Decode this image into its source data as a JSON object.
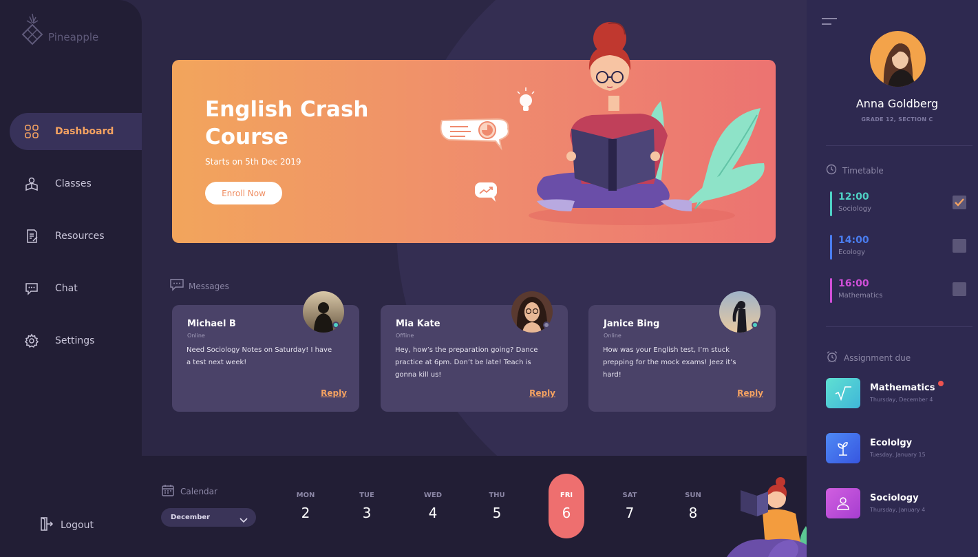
{
  "logo": {
    "name": "Pineapple"
  },
  "nav": {
    "items": [
      {
        "label": "Dashboard",
        "icon": "grid-icon",
        "active": true
      },
      {
        "label": "Classes",
        "icon": "classes-icon",
        "active": false
      },
      {
        "label": "Resources",
        "icon": "resources-icon",
        "active": false
      },
      {
        "label": "Chat",
        "icon": "chat-icon",
        "active": false
      },
      {
        "label": "Settings",
        "icon": "gear-icon",
        "active": false
      }
    ],
    "logout": "Logout"
  },
  "banner": {
    "title": "English Crash Course",
    "subtitle": "Starts on 5th Dec 2019",
    "button": "Enroll Now"
  },
  "messages": {
    "heading": "Messages",
    "reply_label": "Reply",
    "cards": [
      {
        "name": "Michael B",
        "status": "Online",
        "text": "Need Sociology Notes on Saturday! I have a test next week!"
      },
      {
        "name": "Mia Kate",
        "status": "Offline",
        "text": "Hey, how’s the preparation going? Dance practice at 6pm. Don’t be late! Teach is gonna kill us!"
      },
      {
        "name": "Janice Bing",
        "status": "Online",
        "text": "How was your English test, I’m stuck prepping for the mock exams! Jeez it’s hard!"
      }
    ]
  },
  "calendar": {
    "heading": "Calendar",
    "month": "December",
    "days": [
      {
        "name": "MON",
        "date": "2"
      },
      {
        "name": "TUE",
        "date": "3"
      },
      {
        "name": "WED",
        "date": "4"
      },
      {
        "name": "THU",
        "date": "5"
      },
      {
        "name": "FRI",
        "date": "6",
        "active": true
      },
      {
        "name": "SAT",
        "date": "7"
      },
      {
        "name": "SUN",
        "date": "8"
      }
    ]
  },
  "profile": {
    "name": "Anna Goldberg",
    "grade": "GRADE 12, SECTION C"
  },
  "timetable": {
    "heading": "Timetable",
    "items": [
      {
        "time": "12:00",
        "subject": "Sociology",
        "color": "#4fd1c5",
        "checked": true
      },
      {
        "time": "14:00",
        "subject": "Ecology",
        "color": "#4a7df0",
        "checked": false
      },
      {
        "time": "16:00",
        "subject": "Mathematics",
        "color": "#d04fd8",
        "checked": false
      }
    ]
  },
  "assignments": {
    "heading": "Assignment due",
    "items": [
      {
        "title": "Mathematics",
        "date": "Thursday, December 4",
        "color": "#4fc7d8",
        "new": true
      },
      {
        "title": "Ecololgy",
        "date": "Tuesday, January 15",
        "color": "#3f6ef0",
        "new": false
      },
      {
        "title": "Sociology",
        "date": "Thursday, January 4",
        "color": "#c34fd8",
        "new": false
      }
    ]
  },
  "colors": {
    "accent": "#f4a261",
    "sidebar": "#221e35",
    "background": "#2c2745",
    "card": "#4a4268",
    "calendar_active": "#ee6f6f"
  }
}
